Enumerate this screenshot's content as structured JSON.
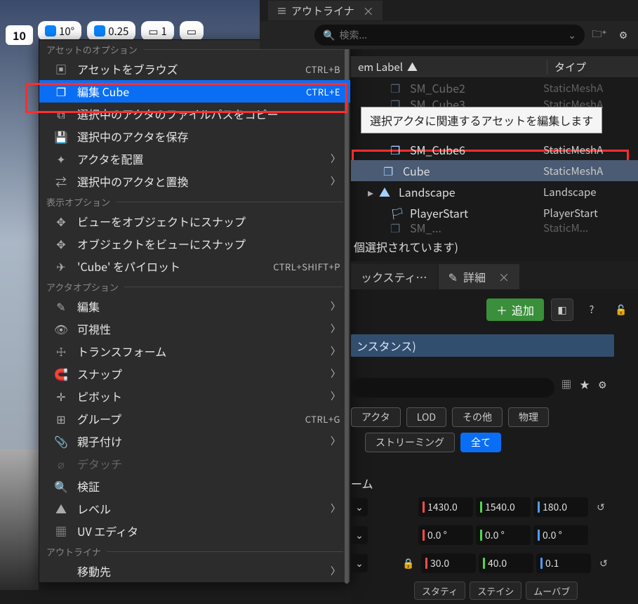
{
  "toolbar": {
    "snap_value": "10",
    "angle": "10°",
    "scale": "0.25",
    "cam": "1"
  },
  "context_menu": {
    "sections": {
      "asset_options": "アセットのオプション",
      "display_options": "表示オプション",
      "actor_options": "アクタオプション",
      "outliner": "アウトライナ",
      "move_to": "移動先"
    },
    "items": {
      "browse_asset": {
        "label": "アセットをブラウズ",
        "shortcut": "CTRL+B"
      },
      "edit_cube": {
        "label": "編集 Cube",
        "shortcut": "CTRL+E"
      },
      "copy_path": {
        "label": "選択中のアクタのファイルパスをコピー"
      },
      "save_actor": {
        "label": "選択中のアクタを保存"
      },
      "place_actor": {
        "label": "アクタを配置"
      },
      "replace_actor": {
        "label": "選択中のアクタと置換"
      },
      "snap_view_to_obj": {
        "label": "ビューをオブジェクトにスナップ"
      },
      "snap_obj_to_view": {
        "label": "オブジェクトをビューにスナップ"
      },
      "pilot_cube": {
        "label": "'Cube' をパイロット",
        "shortcut": "CTRL+SHIFT+P"
      },
      "edit": {
        "label": "編集"
      },
      "visibility": {
        "label": "可視性"
      },
      "transform": {
        "label": "トランスフォーム"
      },
      "snap": {
        "label": "スナップ"
      },
      "pivot": {
        "label": "ピボット"
      },
      "group": {
        "label": "グループ",
        "shortcut": "CTRL+G"
      },
      "attach": {
        "label": "親子付け"
      },
      "detach": {
        "label": "デタッチ"
      },
      "verify": {
        "label": "検証"
      },
      "level": {
        "label": "レベル"
      },
      "uv_editor": {
        "label": "UV エディタ"
      }
    }
  },
  "tooltip": "選択アクタに関連するアセットを編集します",
  "outliner_tab": "アウトライナ",
  "search_placeholder": "検索...",
  "columns": {
    "label": "em Label",
    "type": "タイプ"
  },
  "outliner_rows": [
    {
      "name": "SM_Cube2",
      "type": "StaticMeshA"
    },
    {
      "name": "SM_Cube3",
      "type": "StaticMeshA"
    },
    {
      "name": "SM_Cube6",
      "type": "StaticMeshA"
    },
    {
      "name": "Cube",
      "type": "StaticMeshA"
    },
    {
      "name": "Landscape",
      "type": "Landscape"
    },
    {
      "name": "PlayerStart",
      "type": "PlayerStart"
    },
    {
      "name": "SM_...",
      "type": "StaticM..."
    }
  ],
  "selection_status": "個選択されています)",
  "details_tabs": {
    "static": "ックスティ…",
    "details": "詳細"
  },
  "add_button": "追加",
  "instance_label": "ンスタンス)",
  "filters": {
    "actor": "アクタ",
    "lod": "LOD",
    "misc": "その他",
    "physics": "物理",
    "streaming": "ストリーミング",
    "all": "全て"
  },
  "section_transform": "ーム",
  "transform": {
    "location": {
      "x": "1430.0",
      "y": "1540.0",
      "z": "180.0"
    },
    "rotation": {
      "x": "0.0 °",
      "y": "0.0 °",
      "z": "0.0 °"
    },
    "scale": {
      "x": "30.0",
      "y": "40.0",
      "z": "0.1"
    }
  },
  "mobility": {
    "static": "スタティ",
    "station": "ステイシ",
    "movable": "ムーバブ"
  }
}
